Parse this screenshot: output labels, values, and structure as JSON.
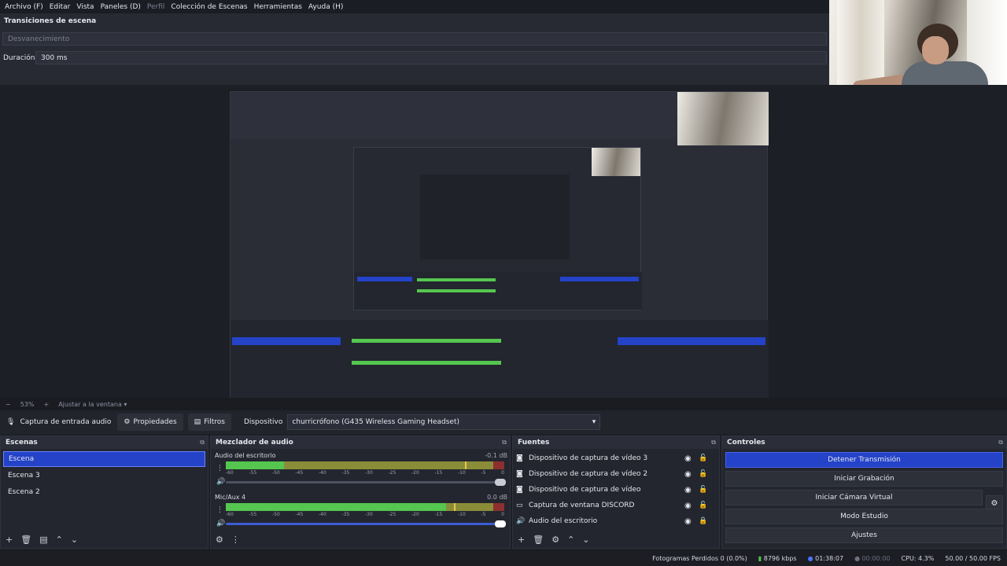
{
  "menu": [
    "Archivo (F)",
    "Editar",
    "Vista",
    "Paneles (D)",
    "Perfil",
    "Colección de Escenas",
    "Herramientas",
    "Ayuda (H)"
  ],
  "transitions": {
    "title": "Transiciones de escena",
    "effect": "Desvanecimiento",
    "duration_label": "Duración",
    "duration_value": "300 ms"
  },
  "zoom": {
    "minus": "−",
    "percent": "53%",
    "plus": "+",
    "fit": "Ajustar a la ventana"
  },
  "source_bar": {
    "source_name": "Captura de entrada audio",
    "properties": "Propiedades",
    "filters": "Filtros",
    "device_label": "Dispositivo",
    "device_value": "churricrófono (G435 Wireless Gaming Headset)"
  },
  "scenes": {
    "title": "Escenas",
    "items": [
      "Escena",
      "Escena 3",
      "Escena 2"
    ],
    "active": 0
  },
  "mixer": {
    "title": "Mezclador de audio",
    "channels": [
      {
        "name": "Audio del escritorio",
        "db": "-0.1 dB",
        "level": 0.21,
        "yellow_from": 0.83,
        "peak": 0.86,
        "volume": 1.0,
        "muted": false
      },
      {
        "name": "Mic/Aux 4",
        "db": "0.0 dB",
        "level": 0.79,
        "yellow_from": 0.83,
        "peak": 0.82,
        "volume": 1.0,
        "muted": false
      }
    ],
    "ticks": [
      "-60",
      "-55",
      "-50",
      "-45",
      "-40",
      "-35",
      "-30",
      "-25",
      "-20",
      "-15",
      "-10",
      "-5",
      "0"
    ]
  },
  "sources": {
    "title": "Fuentes",
    "items": [
      {
        "name": "Dispositivo de captura de vídeo 3",
        "icon": "camera-icon",
        "locked": false
      },
      {
        "name": "Dispositivo de captura de vídeo 2",
        "icon": "camera-icon",
        "locked": false
      },
      {
        "name": "Dispositivo de captura de vídeo",
        "icon": "camera-icon",
        "locked": false
      },
      {
        "name": "Captura de ventana DISCORD",
        "icon": "window-icon",
        "locked": false
      },
      {
        "name": "Audio del escritorio",
        "icon": "speaker-icon",
        "locked": true
      }
    ]
  },
  "controls": {
    "title": "Controles",
    "stop_stream": "Detener Transmisión",
    "start_record": "Iniciar Grabación",
    "virtual_cam": "Iniciar Cámara Virtual",
    "studio_mode": "Modo Estudio",
    "settings": "Ajustes"
  },
  "status": {
    "dropped_frames": "Fotogramas Perdidos 0 (0.0%)",
    "bitrate": "8796 kbps",
    "live_time": "01:38:07",
    "rec_time": "00:00:00",
    "cpu": "CPU: 4.3%",
    "fps": "50.00 / 50.00 FPS"
  },
  "colors": {
    "accent": "#2443c8",
    "meter_green": "#55c650",
    "meter_yellow": "#8a8d38",
    "meter_red": "#8d2f2f"
  }
}
